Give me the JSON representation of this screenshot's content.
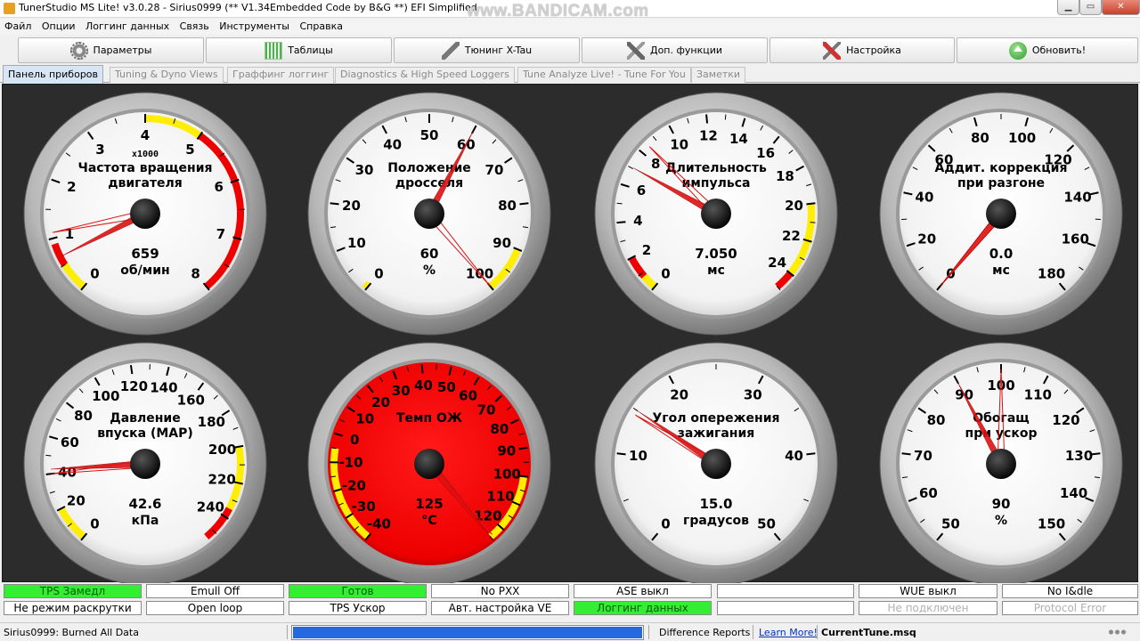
{
  "window": {
    "title": "TunerStudio MS Lite! v3.0.28 - Sirius0999 (** V1.34Embedded Code by B&G **) EFI Simplified",
    "watermark": "www.BANDICAM.com"
  },
  "menu": [
    "Файл",
    "Опции",
    "Логгинг данных",
    "Связь",
    "Инструменты",
    "Справка"
  ],
  "toolbar": {
    "parameters": "Параметры",
    "tables": "Таблицы",
    "tuning": "Тюнинг X-Tau",
    "extra": "Доп. функции",
    "settings": "Настройка",
    "update": "Обновить!"
  },
  "tabs": [
    "Панель приборов",
    "Tuning & Dyno Views",
    "Граффинг логгинг",
    "Diagnostics & High Speed Loggers",
    "Tune Analyze Live! - Tune For You",
    "Заметки"
  ],
  "colors": {
    "warn_yellow": "#ffee00",
    "danger_red": "#ee0000",
    "needle": "#dd1111",
    "on_green": "#33ee33"
  },
  "gauges": [
    {
      "title": [
        "Частота вращения",
        "двигателя"
      ],
      "value": "659",
      "unit": "об/мин",
      "multiplier": "x1000",
      "min": 0,
      "max": 8,
      "reading": 0.659,
      "peak": 1.1,
      "ticks": [
        0,
        1,
        2,
        3,
        4,
        5,
        6,
        7,
        8
      ],
      "zones": [
        {
          "from": 0,
          "to": 0.5,
          "color": "yellow"
        },
        {
          "from": 0.5,
          "to": 0.9,
          "color": "red"
        },
        {
          "from": 4,
          "to": 5,
          "color": "yellow"
        },
        {
          "from": 5,
          "to": 8,
          "color": "red"
        }
      ]
    },
    {
      "title": [
        "Положение",
        "дросселя"
      ],
      "value": "60",
      "unit": "%",
      "min": 0,
      "max": 100,
      "reading": 60,
      "peak": 100,
      "ticks": [
        0,
        10,
        20,
        30,
        40,
        50,
        60,
        70,
        80,
        90,
        100
      ],
      "zones": [
        {
          "from": 0,
          "to": 1,
          "color": "yellow"
        },
        {
          "from": 90,
          "to": 100,
          "color": "yellow"
        }
      ]
    },
    {
      "title": [
        "Длительность",
        "импульса"
      ],
      "value": "7.050",
      "unit": "мс",
      "min": 0,
      "max": 25,
      "reading": 7.05,
      "peak": 8.5,
      "ticks": [
        0,
        2,
        4,
        6,
        8,
        10,
        12,
        14,
        16,
        18,
        20,
        22,
        24
      ],
      "zones": [
        {
          "from": 0,
          "to": 0.8,
          "color": "yellow"
        },
        {
          "from": 0.8,
          "to": 2,
          "color": "red"
        },
        {
          "from": 20,
          "to": 24,
          "color": "yellow"
        },
        {
          "from": 24,
          "to": 25,
          "color": "red"
        }
      ]
    },
    {
      "title": [
        "Аддит. коррекция",
        "при разгоне"
      ],
      "value": "0.0",
      "unit": "мс",
      "min": 0,
      "max": 180,
      "reading": 0,
      "peak": 0,
      "ticks": [
        0,
        20,
        40,
        60,
        80,
        100,
        120,
        140,
        160,
        180
      ],
      "zones": []
    },
    {
      "title": [
        "Давление",
        "впуска (MAP)"
      ],
      "value": "42.6",
      "unit": "кПа",
      "min": 0,
      "max": 255,
      "reading": 42.6,
      "peak": 40,
      "ticks": [
        0,
        20,
        40,
        60,
        80,
        100,
        120,
        140,
        160,
        180,
        200,
        220,
        240
      ],
      "zones": [
        {
          "from": 0,
          "to": 20,
          "color": "yellow"
        },
        {
          "from": 200,
          "to": 235,
          "color": "yellow"
        },
        {
          "from": 235,
          "to": 255,
          "color": "red"
        }
      ]
    },
    {
      "title": [
        "Темп ОЖ"
      ],
      "value": "125",
      "unit": "°C",
      "face": "red",
      "min": -40,
      "max": 125,
      "reading": 125,
      "peak": 124,
      "ticks": [
        -40,
        -30,
        -20,
        -10,
        0,
        10,
        20,
        30,
        40,
        50,
        60,
        70,
        80,
        90,
        100,
        110,
        120
      ],
      "zones": [
        {
          "from": -40,
          "to": -5,
          "color": "yellow"
        },
        {
          "from": 100,
          "to": 125,
          "color": "yellow"
        }
      ]
    },
    {
      "title": [
        "Угол опережения",
        "зажигания"
      ],
      "value": "15.0",
      "unit": "градусов",
      "min": 0,
      "max": 50,
      "reading": 15,
      "peak": 14.5,
      "ticks": [
        0,
        10,
        20,
        30,
        40,
        50
      ],
      "zones": []
    },
    {
      "title": [
        "Обогащ",
        "при ускор"
      ],
      "value": "90",
      "unit": "%",
      "min": 50,
      "max": 150,
      "reading": 90,
      "peak": 100,
      "ticks": [
        50,
        60,
        70,
        80,
        90,
        100,
        110,
        120,
        130,
        140,
        150
      ],
      "zones": []
    }
  ],
  "indicators": [
    {
      "label": "TPS Замедл",
      "state": "on"
    },
    {
      "label": "Не режим раскрутки",
      "state": "off"
    },
    {
      "label": "Emull Off",
      "state": "off"
    },
    {
      "label": "Open loop",
      "state": "off"
    },
    {
      "label": "Готов",
      "state": "on"
    },
    {
      "label": "TPS Ускор",
      "state": "off"
    },
    {
      "label": "No PXX",
      "state": "off"
    },
    {
      "label": "Авт. настройка VE",
      "state": "off"
    },
    {
      "label": "ASE выкл",
      "state": "off"
    },
    {
      "label": "Логгинг данных",
      "state": "on"
    },
    {
      "label": "",
      "state": "off"
    },
    {
      "label": "",
      "state": "off"
    },
    {
      "label": "WUE выкл",
      "state": "off"
    },
    {
      "label": "Не подключен",
      "state": "dim"
    },
    {
      "label": "No I&dle",
      "state": "off"
    },
    {
      "label": "Protocol Error",
      "state": "dim"
    }
  ],
  "status": {
    "message": "Sirius0999: Burned All Data",
    "progress": 1.0,
    "diff_reports": "Difference Reports",
    "learn_more": "Learn More!",
    "file": "CurrentTune.msq"
  }
}
